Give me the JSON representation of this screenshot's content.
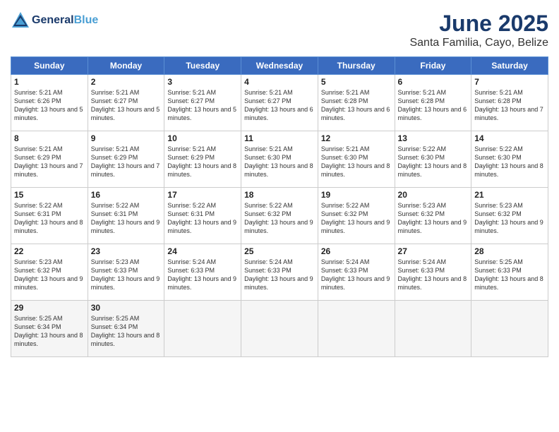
{
  "header": {
    "logo_line1": "General",
    "logo_line2": "Blue",
    "month": "June 2025",
    "location": "Santa Familia, Cayo, Belize"
  },
  "weekdays": [
    "Sunday",
    "Monday",
    "Tuesday",
    "Wednesday",
    "Thursday",
    "Friday",
    "Saturday"
  ],
  "weeks": [
    [
      {
        "day": "1",
        "sunrise": "Sunrise: 5:21 AM",
        "sunset": "Sunset: 6:26 PM",
        "daylight": "Daylight: 13 hours and 5 minutes."
      },
      {
        "day": "2",
        "sunrise": "Sunrise: 5:21 AM",
        "sunset": "Sunset: 6:27 PM",
        "daylight": "Daylight: 13 hours and 5 minutes."
      },
      {
        "day": "3",
        "sunrise": "Sunrise: 5:21 AM",
        "sunset": "Sunset: 6:27 PM",
        "daylight": "Daylight: 13 hours and 5 minutes."
      },
      {
        "day": "4",
        "sunrise": "Sunrise: 5:21 AM",
        "sunset": "Sunset: 6:27 PM",
        "daylight": "Daylight: 13 hours and 6 minutes."
      },
      {
        "day": "5",
        "sunrise": "Sunrise: 5:21 AM",
        "sunset": "Sunset: 6:28 PM",
        "daylight": "Daylight: 13 hours and 6 minutes."
      },
      {
        "day": "6",
        "sunrise": "Sunrise: 5:21 AM",
        "sunset": "Sunset: 6:28 PM",
        "daylight": "Daylight: 13 hours and 6 minutes."
      },
      {
        "day": "7",
        "sunrise": "Sunrise: 5:21 AM",
        "sunset": "Sunset: 6:28 PM",
        "daylight": "Daylight: 13 hours and 7 minutes."
      }
    ],
    [
      {
        "day": "8",
        "sunrise": "Sunrise: 5:21 AM",
        "sunset": "Sunset: 6:29 PM",
        "daylight": "Daylight: 13 hours and 7 minutes."
      },
      {
        "day": "9",
        "sunrise": "Sunrise: 5:21 AM",
        "sunset": "Sunset: 6:29 PM",
        "daylight": "Daylight: 13 hours and 7 minutes."
      },
      {
        "day": "10",
        "sunrise": "Sunrise: 5:21 AM",
        "sunset": "Sunset: 6:29 PM",
        "daylight": "Daylight: 13 hours and 8 minutes."
      },
      {
        "day": "11",
        "sunrise": "Sunrise: 5:21 AM",
        "sunset": "Sunset: 6:30 PM",
        "daylight": "Daylight: 13 hours and 8 minutes."
      },
      {
        "day": "12",
        "sunrise": "Sunrise: 5:21 AM",
        "sunset": "Sunset: 6:30 PM",
        "daylight": "Daylight: 13 hours and 8 minutes."
      },
      {
        "day": "13",
        "sunrise": "Sunrise: 5:22 AM",
        "sunset": "Sunset: 6:30 PM",
        "daylight": "Daylight: 13 hours and 8 minutes."
      },
      {
        "day": "14",
        "sunrise": "Sunrise: 5:22 AM",
        "sunset": "Sunset: 6:30 PM",
        "daylight": "Daylight: 13 hours and 8 minutes."
      }
    ],
    [
      {
        "day": "15",
        "sunrise": "Sunrise: 5:22 AM",
        "sunset": "Sunset: 6:31 PM",
        "daylight": "Daylight: 13 hours and 8 minutes."
      },
      {
        "day": "16",
        "sunrise": "Sunrise: 5:22 AM",
        "sunset": "Sunset: 6:31 PM",
        "daylight": "Daylight: 13 hours and 9 minutes."
      },
      {
        "day": "17",
        "sunrise": "Sunrise: 5:22 AM",
        "sunset": "Sunset: 6:31 PM",
        "daylight": "Daylight: 13 hours and 9 minutes."
      },
      {
        "day": "18",
        "sunrise": "Sunrise: 5:22 AM",
        "sunset": "Sunset: 6:32 PM",
        "daylight": "Daylight: 13 hours and 9 minutes."
      },
      {
        "day": "19",
        "sunrise": "Sunrise: 5:22 AM",
        "sunset": "Sunset: 6:32 PM",
        "daylight": "Daylight: 13 hours and 9 minutes."
      },
      {
        "day": "20",
        "sunrise": "Sunrise: 5:23 AM",
        "sunset": "Sunset: 6:32 PM",
        "daylight": "Daylight: 13 hours and 9 minutes."
      },
      {
        "day": "21",
        "sunrise": "Sunrise: 5:23 AM",
        "sunset": "Sunset: 6:32 PM",
        "daylight": "Daylight: 13 hours and 9 minutes."
      }
    ],
    [
      {
        "day": "22",
        "sunrise": "Sunrise: 5:23 AM",
        "sunset": "Sunset: 6:32 PM",
        "daylight": "Daylight: 13 hours and 9 minutes."
      },
      {
        "day": "23",
        "sunrise": "Sunrise: 5:23 AM",
        "sunset": "Sunset: 6:33 PM",
        "daylight": "Daylight: 13 hours and 9 minutes."
      },
      {
        "day": "24",
        "sunrise": "Sunrise: 5:24 AM",
        "sunset": "Sunset: 6:33 PM",
        "daylight": "Daylight: 13 hours and 9 minutes."
      },
      {
        "day": "25",
        "sunrise": "Sunrise: 5:24 AM",
        "sunset": "Sunset: 6:33 PM",
        "daylight": "Daylight: 13 hours and 9 minutes."
      },
      {
        "day": "26",
        "sunrise": "Sunrise: 5:24 AM",
        "sunset": "Sunset: 6:33 PM",
        "daylight": "Daylight: 13 hours and 9 minutes."
      },
      {
        "day": "27",
        "sunrise": "Sunrise: 5:24 AM",
        "sunset": "Sunset: 6:33 PM",
        "daylight": "Daylight: 13 hours and 8 minutes."
      },
      {
        "day": "28",
        "sunrise": "Sunrise: 5:25 AM",
        "sunset": "Sunset: 6:33 PM",
        "daylight": "Daylight: 13 hours and 8 minutes."
      }
    ],
    [
      {
        "day": "29",
        "sunrise": "Sunrise: 5:25 AM",
        "sunset": "Sunset: 6:34 PM",
        "daylight": "Daylight: 13 hours and 8 minutes."
      },
      {
        "day": "30",
        "sunrise": "Sunrise: 5:25 AM",
        "sunset": "Sunset: 6:34 PM",
        "daylight": "Daylight: 13 hours and 8 minutes."
      },
      null,
      null,
      null,
      null,
      null
    ]
  ]
}
